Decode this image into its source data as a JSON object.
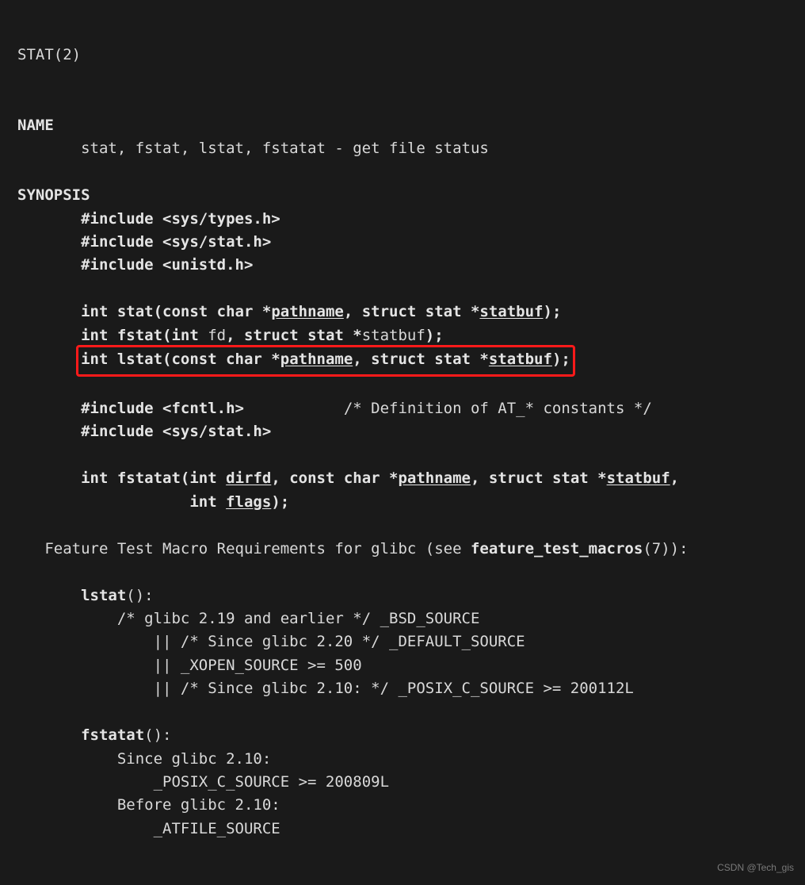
{
  "header": "STAT(2)",
  "sec_name": "NAME",
  "name_line": "stat, fstat, lstat, fstatat - get file status",
  "sec_syn": "SYNOPSIS",
  "inc1": "#include <sys/types.h>",
  "inc2": "#include <sys/stat.h>",
  "inc3": "#include <unistd.h>",
  "stat": {
    "ret": "int ",
    "fn": "stat(const char *",
    "a1": "pathname",
    "mid": ", struct stat *",
    "a2": "statbuf",
    "end": ");"
  },
  "fstat": {
    "ret": "int ",
    "fn1": "fstat(int ",
    "fd": "fd",
    "mid": ", struct stat *",
    "buf": "statbuf",
    "end": ");"
  },
  "lstat": {
    "ret": "int ",
    "fn": "lstat(const char *",
    "a1": "pathname",
    "mid": ", struct stat *",
    "a2": "statbuf",
    "end": ");"
  },
  "inc4": "#include <fcntl.h>",
  "inc4_comment": "/* Definition of AT_* constants */",
  "inc5": "#include <sys/stat.h>",
  "fstatat": {
    "ret": "int ",
    "fn": "fstatat(int ",
    "a1": "dirfd",
    "p2": ", const char *",
    "a2": "pathname",
    "p3": ", struct stat *",
    "a3": "statbuf",
    "comma": ",",
    "ret2": "int ",
    "a4": "flags",
    "end": ");"
  },
  "ftm_pre": "Feature Test Macro Requirements for glibc (see ",
  "ftm_bold": "feature_test_macros",
  "ftm_post": "(7)):",
  "lstat_hdr": "lstat",
  "lstat_paren": "():",
  "l1": "/* glibc 2.19 and earlier */ _BSD_SOURCE",
  "l2": "|| /* Since glibc 2.20 */ _DEFAULT_SOURCE",
  "l3": "|| _XOPEN_SOURCE >= 500",
  "l4": "|| /* Since glibc 2.10: */ _POSIX_C_SOURCE >= 200112L",
  "fstatat_hdr": "fstatat",
  "fstatat_paren": "():",
  "f1": "Since glibc 2.10:",
  "f2": "_POSIX_C_SOURCE >= 200809L",
  "f3": "Before glibc 2.10:",
  "f4": "_ATFILE_SOURCE",
  "watermark": "CSDN @Tech_gis"
}
